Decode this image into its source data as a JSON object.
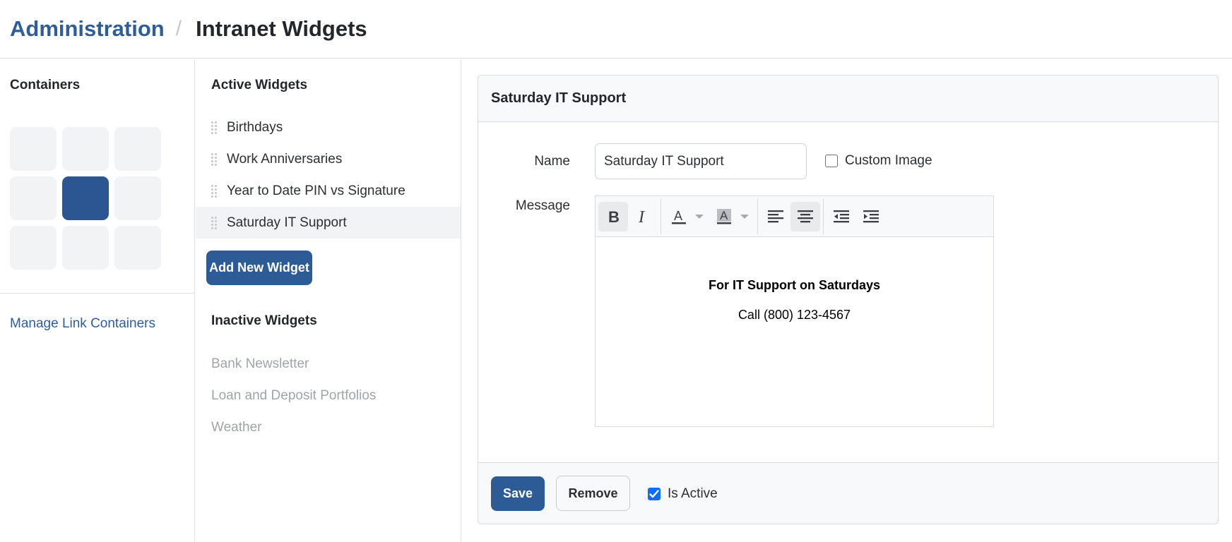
{
  "breadcrumb": {
    "parent": "Administration",
    "separator": "/",
    "current": "Intranet Widgets"
  },
  "containers": {
    "title": "Containers",
    "grid_cells": 9,
    "active_cell_index": 4,
    "manage_link": "Manage Link Containers"
  },
  "active_widgets": {
    "title": "Active Widgets",
    "items": [
      "Birthdays",
      "Work Anniversaries",
      "Year to Date PIN vs Signature",
      "Saturday IT Support"
    ],
    "selected_index": 3,
    "add_button": "Add New Widget"
  },
  "inactive_widgets": {
    "title": "Inactive Widgets",
    "items": [
      "Bank Newsletter",
      "Loan and Deposit Portfolios",
      "Weather"
    ]
  },
  "editor_panel": {
    "title": "Saturday IT Support",
    "name_label": "Name",
    "name_value": "Saturday IT Support",
    "custom_image_label": "Custom Image",
    "custom_image_checked": false,
    "message_label": "Message",
    "toolbar_icons": [
      "bold-icon",
      "italic-icon",
      "font-color-icon",
      "highlight-color-icon",
      "align-left-icon",
      "align-center-icon",
      "outdent-icon",
      "indent-icon"
    ],
    "message_heading": "For IT Support on Saturdays",
    "message_line": "Call (800) 123-4567",
    "save_button": "Save",
    "remove_button": "Remove",
    "is_active_label": "Is Active",
    "is_active_checked": true
  },
  "colors": {
    "brand_blue": "#2c5b96",
    "link_blue": "#2e5e99",
    "checkbox_blue": "#0d6efd"
  }
}
